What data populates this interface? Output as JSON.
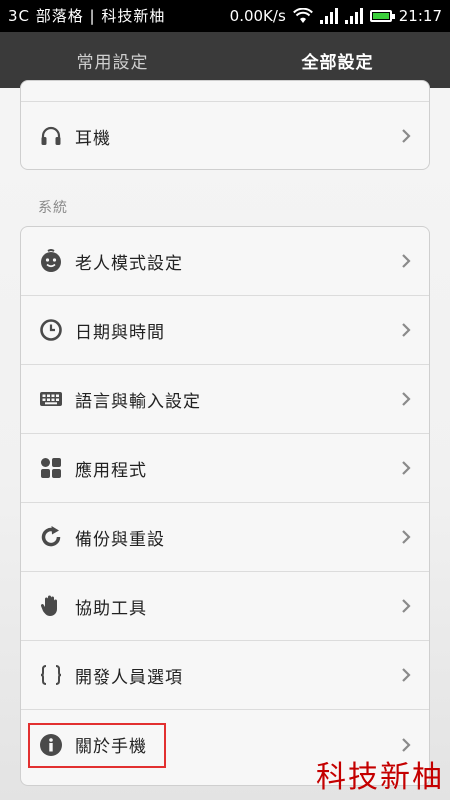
{
  "statusbar": {
    "left_text": "3C 部落格 | 科技新柚",
    "network_speed": "0.00K/s",
    "time": "21:17",
    "icons": [
      "wifi-icon",
      "signal-icon",
      "signal-icon",
      "battery-icon"
    ]
  },
  "tabs": [
    {
      "label": "常用設定",
      "active": false
    },
    {
      "label": "全部設定",
      "active": true
    }
  ],
  "top_card": {
    "items": [
      {
        "label": "耳機",
        "icon": "headphones-icon"
      }
    ]
  },
  "section": {
    "title": "系統"
  },
  "system_items": [
    {
      "label": "老人模式設定",
      "icon": "elder-mode-icon"
    },
    {
      "label": "日期與時間",
      "icon": "clock-icon"
    },
    {
      "label": "語言與輸入設定",
      "icon": "keyboard-icon"
    },
    {
      "label": "應用程式",
      "icon": "apps-grid-icon"
    },
    {
      "label": "備份與重設",
      "icon": "backup-reset-icon"
    },
    {
      "label": "協助工具",
      "icon": "hand-icon"
    },
    {
      "label": "開發人員選項",
      "icon": "braces-icon"
    },
    {
      "label": "關於手機",
      "icon": "info-icon"
    }
  ],
  "watermark": "科技新柚",
  "colors": {
    "tabbar": "#3a3a3a",
    "highlight": "#e23030",
    "watermark": "#c40000",
    "battery": "#3bcf3b"
  }
}
